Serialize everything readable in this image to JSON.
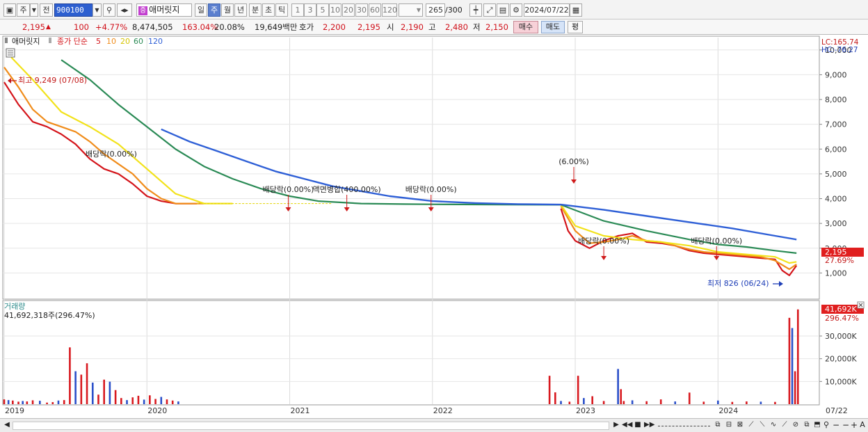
{
  "toolbar": {
    "market_type": "주",
    "prev_label": "전",
    "symbol_code": "900100",
    "stock_badge": "증",
    "stock_name": "애머릿지",
    "periods": [
      "일",
      "주",
      "월",
      "년",
      "분",
      "초",
      "틱"
    ],
    "active_period": "주",
    "intervals": [
      "1",
      "3",
      "5",
      "10",
      "20",
      "30",
      "60",
      "120"
    ],
    "count": "265",
    "count_total": "/300",
    "date": "2024/07/22"
  },
  "quote": {
    "price": "2,195",
    "arrow": "▲",
    "change": "100",
    "change_pct": "+4.77%",
    "volume": "8,474,505",
    "volume_ratio": "163.04%",
    "turnover": "20.08%",
    "amount": "19,649백만",
    "bid_label": "호가",
    "bid1": "2,200",
    "bid2": "2,195",
    "open_label": "시",
    "open": "2,190",
    "high_label": "고",
    "high": "2,480",
    "low_label": "저",
    "low": "2,150",
    "buy_button": "매수",
    "sell_button": "매도",
    "avg_button": "평"
  },
  "price_panel": {
    "legend_name": "애머릿지",
    "legend_ma_title": "종가 단순",
    "ma_periods": [
      "5",
      "10",
      "20",
      "60",
      "120"
    ],
    "ma_colors": [
      "#d4141a",
      "#f08c1a",
      "#f2e21a",
      "#2a8a55",
      "#2e5fd6"
    ],
    "lc_label": "LC:165.74",
    "hc_label": "HC:-76.27",
    "current_price_tag": "2,195",
    "current_pct_tag": "27.69%",
    "high_marker": "최고 9,249 (07/08)",
    "low_marker": "최저 826 (06/24)",
    "events": [
      {
        "text": "배당락(0.00%)",
        "x": "2019-11"
      },
      {
        "text": "배당락(0.00%)",
        "x": "2020-12"
      },
      {
        "text": "액면병합(400.00%)",
        "x": "2021-05"
      },
      {
        "text": "배당락(0.00%)",
        "x": "2021-12"
      },
      {
        "text": "(6.00%)",
        "x": "2022-12"
      },
      {
        "text": "배당락(0.00%)",
        "x": "2023-02"
      },
      {
        "text": "배당락(0.00%)",
        "x": "2023-12"
      }
    ]
  },
  "volume_panel": {
    "title": "거래량",
    "value_label": "41,692,318주(296.47%)",
    "current_tag": "41,692K",
    "current_pct_tag": "296.47%"
  },
  "chart_data": [
    {
      "type": "line",
      "title": "",
      "y_axis": {
        "min": 0,
        "max": 10500,
        "ticks": [
          "1,000",
          "2,000",
          "3,000",
          "4,000",
          "5,000",
          "6,000",
          "7,000",
          "8,000",
          "9,000",
          "10,000"
        ]
      },
      "x_ticks": [
        "2019",
        "2020",
        "2021",
        "2022",
        "2023",
        "2024",
        "07/22"
      ],
      "series": [
        {
          "name": "5",
          "x": [
            2019.0,
            2019.1,
            2019.2,
            2019.3,
            2019.4,
            2019.5,
            2019.6,
            2019.7,
            2019.8,
            2019.9,
            2020.0,
            2020.1,
            2020.2,
            2020.3,
            2020.35,
            2022.9,
            2022.95,
            2023.0,
            2023.1,
            2023.2,
            2023.3,
            2023.4,
            2023.5,
            2023.6,
            2023.7,
            2023.8,
            2023.9,
            2024.0,
            2024.1,
            2024.2,
            2024.3,
            2024.4,
            2024.45,
            2024.5,
            2024.55
          ],
          "y": [
            8700,
            7800,
            7100,
            6900,
            6600,
            6200,
            5600,
            5200,
            5000,
            4600,
            4100,
            3900,
            3800,
            3800,
            3800,
            3600,
            2700,
            2300,
            2000,
            2300,
            2500,
            2600,
            2250,
            2200,
            2100,
            1900,
            1800,
            1750,
            1700,
            1650,
            1600,
            1550,
            1100,
            900,
            1300
          ]
        },
        {
          "name": "10",
          "x": [
            2019.0,
            2019.1,
            2019.2,
            2019.3,
            2019.4,
            2019.5,
            2019.6,
            2019.7,
            2019.8,
            2019.9,
            2020.0,
            2020.1,
            2020.2,
            2020.3,
            2020.4,
            2022.9,
            2023.0,
            2023.1,
            2023.2,
            2023.3,
            2023.4,
            2023.5,
            2023.6,
            2023.7,
            2023.8,
            2023.9,
            2024.0,
            2024.1,
            2024.2,
            2024.3,
            2024.4,
            2024.5,
            2024.55
          ],
          "y": [
            9300,
            8500,
            7600,
            7100,
            6900,
            6700,
            6300,
            5800,
            5400,
            5000,
            4400,
            4000,
            3800,
            3800,
            3800,
            3700,
            2700,
            2200,
            2250,
            2350,
            2500,
            2300,
            2250,
            2100,
            1950,
            1850,
            1800,
            1750,
            1700,
            1650,
            1500,
            1150,
            1350
          ]
        },
        {
          "name": "20",
          "x": [
            2019.05,
            2019.2,
            2019.4,
            2019.6,
            2019.8,
            2020.0,
            2020.2,
            2020.4,
            2020.6,
            2022.9,
            2023.0,
            2023.2,
            2023.4,
            2023.6,
            2023.8,
            2024.0,
            2024.2,
            2024.4,
            2024.5,
            2024.55
          ],
          "y": [
            9700,
            8800,
            7500,
            6900,
            6200,
            5200,
            4200,
            3800,
            3800,
            3750,
            2900,
            2500,
            2350,
            2250,
            2100,
            1850,
            1750,
            1650,
            1400,
            1450
          ]
        },
        {
          "name": "60",
          "x": [
            2019.4,
            2019.6,
            2019.8,
            2020.0,
            2020.2,
            2020.4,
            2020.6,
            2020.8,
            2021.0,
            2021.2,
            2021.5,
            2021.8,
            2022.0,
            2022.5,
            2022.9,
            2023.2,
            2023.5,
            2023.8,
            2024.0,
            2024.2,
            2024.4,
            2024.55
          ],
          "y": [
            9600,
            8800,
            7800,
            6900,
            6000,
            5300,
            4800,
            4400,
            4100,
            3900,
            3800,
            3780,
            3770,
            3760,
            3750,
            3100,
            2700,
            2350,
            2150,
            2050,
            1900,
            1800
          ]
        },
        {
          "name": "120",
          "x": [
            2020.1,
            2020.3,
            2020.5,
            2020.7,
            2020.9,
            2021.1,
            2021.3,
            2021.5,
            2021.7,
            2022.0,
            2022.3,
            2022.6,
            2022.9,
            2023.2,
            2023.5,
            2023.8,
            2024.1,
            2024.4,
            2024.55
          ],
          "y": [
            6800,
            6300,
            5900,
            5500,
            5100,
            4800,
            4500,
            4300,
            4100,
            3900,
            3820,
            3780,
            3760,
            3550,
            3300,
            3050,
            2800,
            2500,
            2350
          ]
        }
      ]
    },
    {
      "type": "bar",
      "title": "",
      "y_axis": {
        "min": 0,
        "max": 45000,
        "ticks": [
          "10,000K",
          "20,000K",
          "30,000K"
        ]
      },
      "series": [
        {
          "name": "거래량",
          "x": [
            2019.0,
            2019.03,
            2019.06,
            2019.1,
            2019.13,
            2019.16,
            2019.2,
            2019.25,
            2019.3,
            2019.34,
            2019.38,
            2019.42,
            2019.46,
            2019.5,
            2019.54,
            2019.58,
            2019.62,
            2019.66,
            2019.7,
            2019.74,
            2019.78,
            2019.82,
            2019.86,
            2019.9,
            2019.94,
            2019.98,
            2020.02,
            2020.06,
            2020.1,
            2020.14,
            2020.18,
            2020.22,
            2022.82,
            2022.86,
            2022.9,
            2022.96,
            2023.02,
            2023.06,
            2023.12,
            2023.2,
            2023.3,
            2023.32,
            2023.34,
            2023.4,
            2023.5,
            2023.6,
            2023.7,
            2023.8,
            2023.9,
            2024.0,
            2024.1,
            2024.2,
            2024.3,
            2024.4,
            2024.5,
            2024.52,
            2024.54,
            2024.56
          ],
          "y": [
            2100,
            1800,
            1600,
            1100,
            1400,
            1200,
            1700,
            1500,
            700,
            900,
            1600,
            1800,
            25000,
            14500,
            13000,
            18000,
            9500,
            4200,
            10800,
            9900,
            6200,
            2700,
            1800,
            3000,
            3700,
            2000,
            3900,
            2300,
            3200,
            2100,
            1600,
            1200,
            12500,
            5200,
            1400,
            1100,
            12500,
            2700,
            3500,
            1400,
            15500,
            6600,
            1400,
            1700,
            1300,
            2100,
            1200,
            5100,
            1100,
            1600,
            1000,
            1200,
            1100,
            1000,
            38000,
            33500,
            14500,
            41700
          ]
        }
      ]
    }
  ]
}
